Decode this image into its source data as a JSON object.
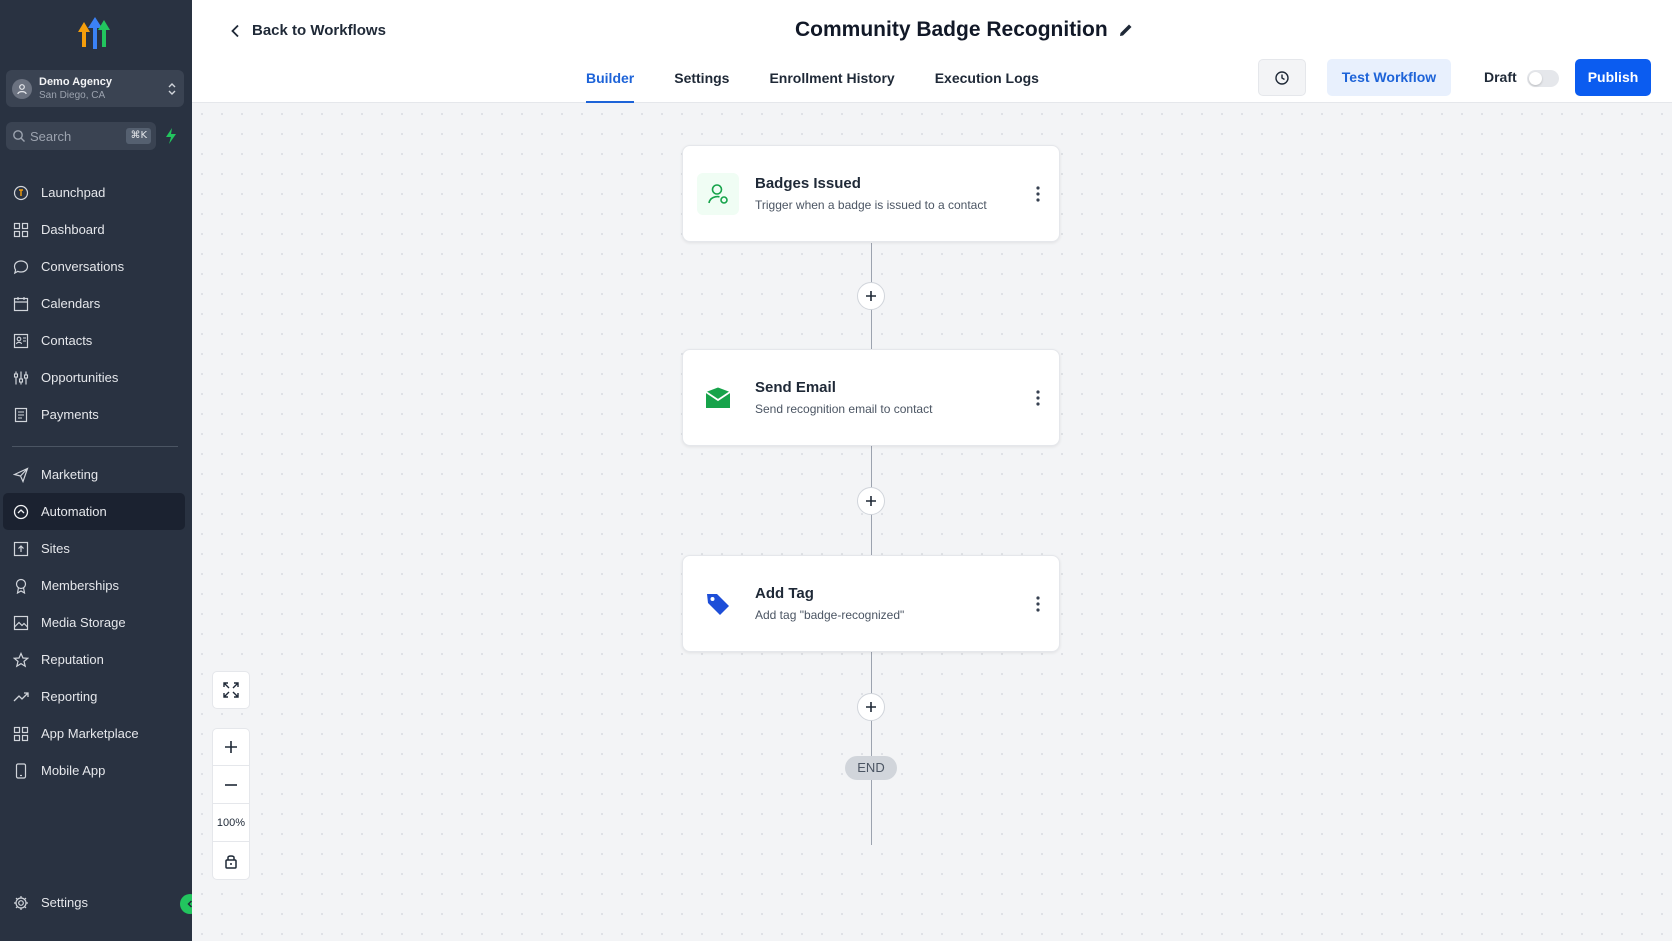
{
  "account": {
    "name": "Demo Agency",
    "location": "San Diego, CA"
  },
  "search": {
    "placeholder": "Search",
    "shortcut": "⌘K"
  },
  "nav": {
    "items": [
      {
        "label": "Launchpad",
        "icon": "launchpad-icon"
      },
      {
        "label": "Dashboard",
        "icon": "grid-icon"
      },
      {
        "label": "Conversations",
        "icon": "chat-icon"
      },
      {
        "label": "Calendars",
        "icon": "calendar-icon"
      },
      {
        "label": "Contacts",
        "icon": "contacts-icon"
      },
      {
        "label": "Opportunities",
        "icon": "sliders-icon"
      },
      {
        "label": "Payments",
        "icon": "receipt-icon"
      }
    ],
    "items2": [
      {
        "label": "Marketing",
        "icon": "send-icon"
      },
      {
        "label": "Automation",
        "icon": "automation-icon",
        "active": true
      },
      {
        "label": "Sites",
        "icon": "sites-icon"
      },
      {
        "label": "Memberships",
        "icon": "award-icon"
      },
      {
        "label": "Media Storage",
        "icon": "image-icon"
      },
      {
        "label": "Reputation",
        "icon": "star-icon"
      },
      {
        "label": "Reporting",
        "icon": "trend-icon"
      },
      {
        "label": "App Marketplace",
        "icon": "grid-icon"
      },
      {
        "label": "Mobile App",
        "icon": "phone-icon"
      }
    ],
    "settings": "Settings"
  },
  "header": {
    "back_label": "Back to Workflows",
    "title": "Community Badge Recognition",
    "tabs": [
      "Builder",
      "Settings",
      "Enrollment History",
      "Execution Logs"
    ],
    "test_label": "Test Workflow",
    "draft_label": "Draft",
    "publish_label": "Publish"
  },
  "workflow": {
    "nodes": [
      {
        "title": "Badges Issued",
        "subtitle": "Trigger when a badge is issued to a contact",
        "icon": "contact-trigger-icon"
      },
      {
        "title": "Send Email",
        "subtitle": "Send recognition email to contact",
        "icon": "email-icon"
      },
      {
        "title": "Add Tag",
        "subtitle": "Add tag \"badge-recognized\"",
        "icon": "tag-icon"
      }
    ],
    "end_label": "END"
  },
  "zoom": {
    "level": "100%"
  },
  "colors": {
    "sidebar_bg": "#293241",
    "accent": "#0b5cf0",
    "tab_active": "#1d63d8",
    "success": "#22c55e"
  }
}
